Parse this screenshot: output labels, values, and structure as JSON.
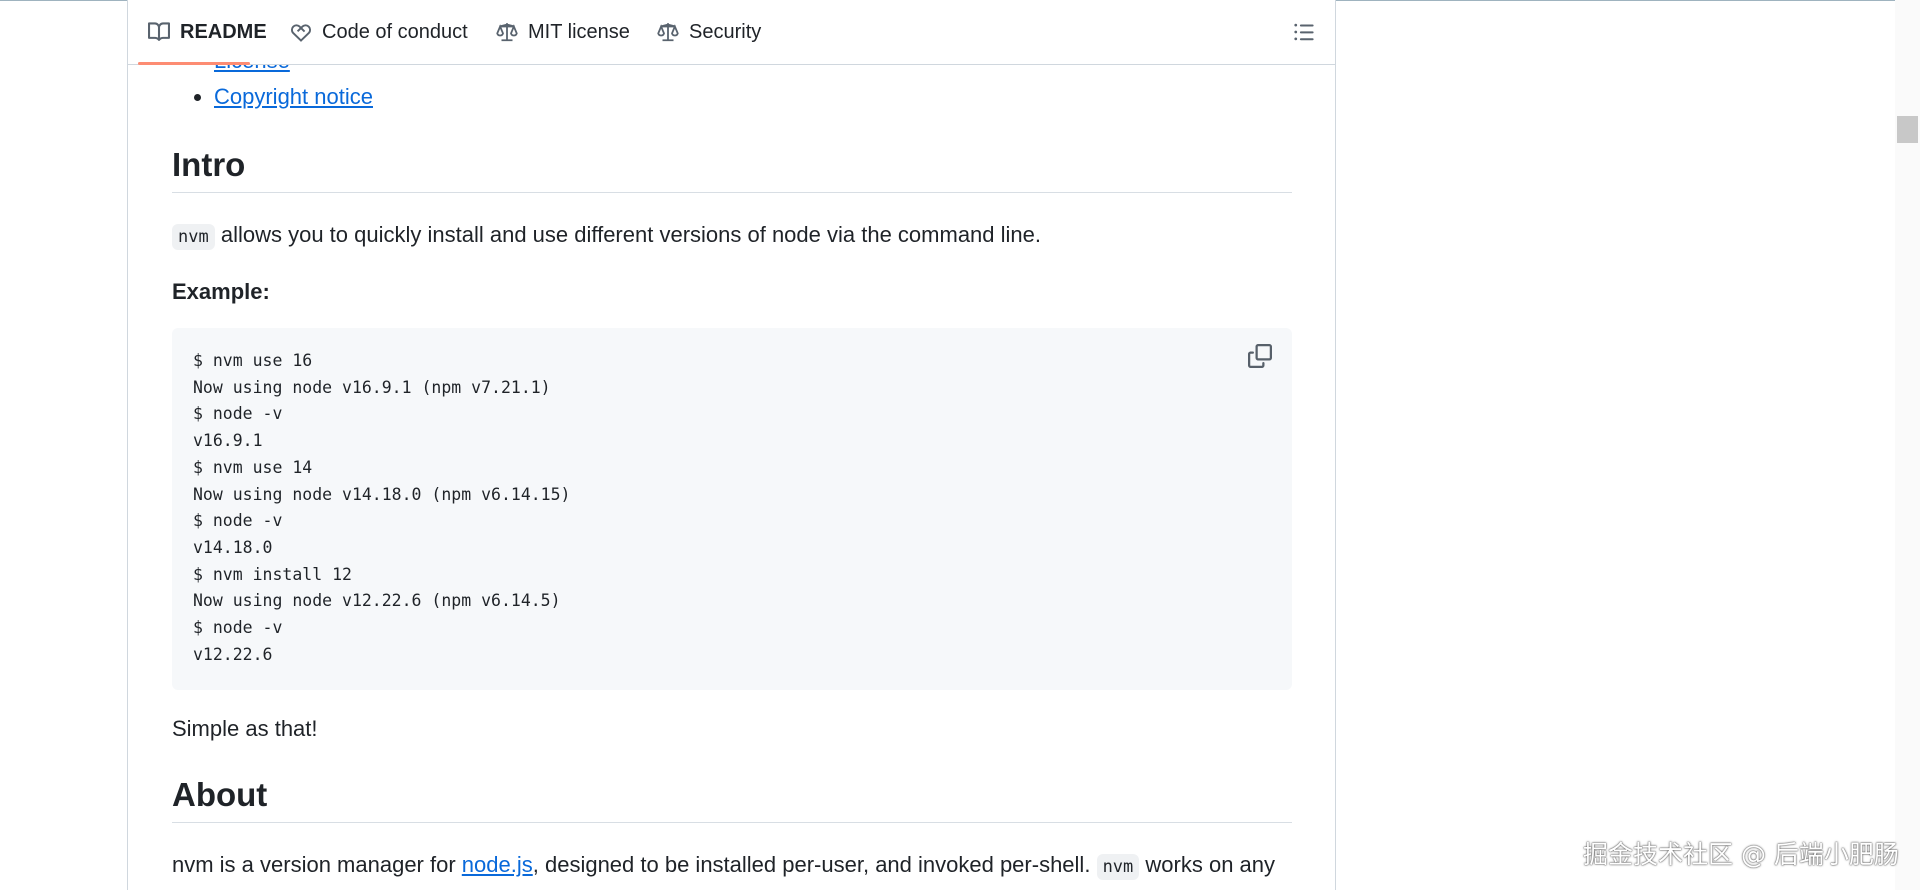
{
  "tabs": [
    {
      "label": "README",
      "icon": "book-icon"
    },
    {
      "label": "Code of conduct",
      "icon": "heart-handshake-icon"
    },
    {
      "label": "MIT license",
      "icon": "law-icon"
    },
    {
      "label": "Security",
      "icon": "law-icon"
    }
  ],
  "toc": {
    "links": [
      "License",
      "Copyright notice"
    ]
  },
  "intro": {
    "heading": "Intro",
    "code_term": "nvm",
    "text": "allows you to quickly install and use different versions of node via the command line.",
    "example_label": "Example:"
  },
  "code_lines": [
    "$ nvm use 16",
    "Now using node v16.9.1 (npm v7.21.1)",
    "$ node -v",
    "v16.9.1",
    "$ nvm use 14",
    "Now using node v14.18.0 (npm v6.14.15)",
    "$ node -v",
    "v14.18.0",
    "$ nvm install 12",
    "Now using node v12.22.6 (npm v6.14.5)",
    "$ node -v",
    "v12.22.6"
  ],
  "simple": "Simple as that!",
  "about": {
    "heading": "About",
    "prefix": "nvm is a version manager for",
    "link": "node.js",
    "middle": ", designed to be installed per-user, and invoked per-shell.",
    "code_term": "nvm",
    "suffix": "works on any"
  },
  "watermark": "掘金技术社区 @ 后端小肥肠",
  "colors": {
    "link": "#0969da",
    "active_tab_underline": "#fd8c73",
    "code_bg": "#f6f8fa"
  }
}
